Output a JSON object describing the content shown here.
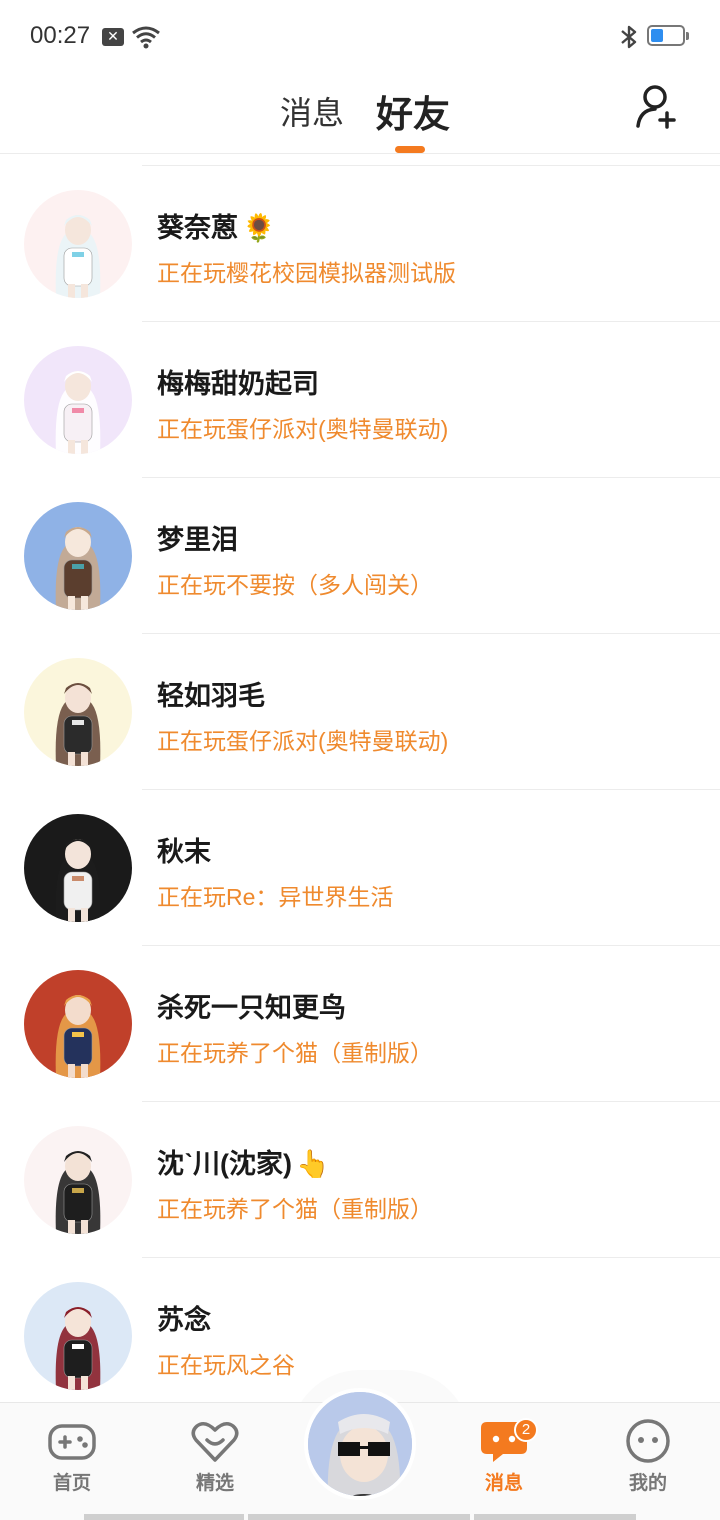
{
  "status_bar": {
    "time": "00:27",
    "notification_icon": "x-badge-icon",
    "wifi_icon": "wifi-icon",
    "bluetooth_icon": "bluetooth-icon",
    "battery_percent": 25,
    "battery_color": "#2e8ef0"
  },
  "header": {
    "tab_messages": "消息",
    "tab_friends": "好友",
    "active_tab": "好友",
    "accent": "#f47a1f",
    "add_friend_icon": "add-user-icon"
  },
  "friends": [
    {
      "name": "葵奈蒽",
      "emoji": "🌻",
      "status": "正在玩樱花校园模拟器测试版"
    },
    {
      "name": "梅梅甜奶起司",
      "emoji": "",
      "status": "正在玩蛋仔派对(奥特曼联动)"
    },
    {
      "name": "梦里泪",
      "emoji": "",
      "status": "正在玩不要按（多人闯关）"
    },
    {
      "name": "轻如羽毛",
      "emoji": "",
      "status": "正在玩蛋仔派对(奥特曼联动)"
    },
    {
      "name": "秋末",
      "emoji": "",
      "status": "正在玩Re：异世界生活"
    },
    {
      "name": "杀死一只知更鸟",
      "emoji": "",
      "status": "正在玩养了个猫（重制版）"
    },
    {
      "name": "沈ˋ川(沈家)",
      "emoji": "👆",
      "status": "正在玩养了个猫（重制版）"
    },
    {
      "name": "苏念",
      "emoji": "",
      "status": "正在玩风之谷"
    }
  ],
  "bottom_nav": {
    "home": "首页",
    "featured": "精选",
    "messages": "消息",
    "profile": "我的",
    "messages_badge": "2",
    "active": "消息"
  }
}
